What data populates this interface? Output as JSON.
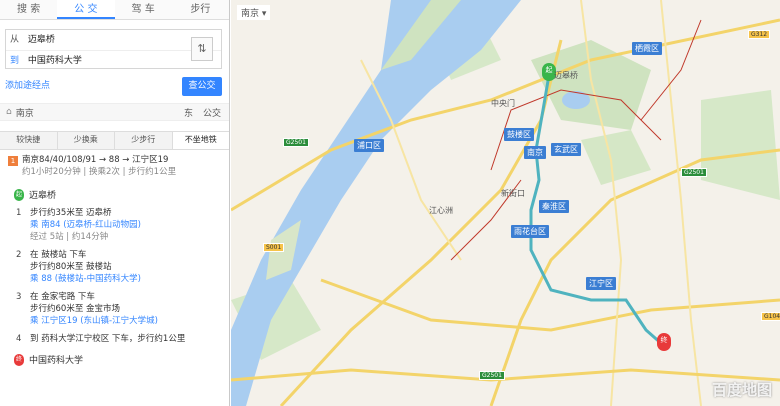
{
  "panel": {
    "tabs": [
      "搜 索",
      "公 交",
      "驾 车",
      "步行"
    ],
    "from_label": "从",
    "from_value": "迈皋桥",
    "to_label": "到",
    "to_value": "中国药科大学",
    "more_link": "添加途经点",
    "search_button": "查公交",
    "city_icon": "home-icon",
    "city": "南京",
    "city_right": [
      "东",
      "公交"
    ],
    "options": [
      "较快捷",
      "少换乘",
      "少步行",
      "不坐地铁"
    ],
    "summary_num": "1",
    "summary_line": "南京84/40/108/91 → 88 → 江宁区19",
    "summary_sub": "约1小时20分钟 | 换乘2次 | 步行约1公里",
    "start_station": "迈皋桥",
    "steps": [
      {
        "n": "1",
        "l1": "步行约35米至 迈皋桥",
        "l2": "乘 南84 (迈皋桥-红山动物园)",
        "l3": "经过 5站 | 约14分钟"
      },
      {
        "n": "2",
        "l1": "在 鼓楼站 下车",
        "l2": "步行约80米至 鼓楼站",
        "l3": "乘 88 (鼓楼站-中国药科大学)"
      },
      {
        "n": "3",
        "l1": "在 金家宅路 下车",
        "l2": "步行约60米至 金宝市场",
        "l3": "乘 江宁区19 (东山镇-江宁大学城)"
      },
      {
        "n": "4",
        "l1": "到 药科大学江宁校区 下车，步行约1公里"
      }
    ],
    "end_station": "中国药科大学"
  },
  "map": {
    "city_select": "南京",
    "labels": [
      {
        "t": "迈皋桥",
        "k": "l1"
      },
      {
        "t": "玄武区",
        "k": "l2"
      },
      {
        "t": "鼓楼区",
        "k": "l3"
      },
      {
        "t": "南京",
        "k": "l4"
      },
      {
        "t": "秦淮区",
        "k": "l5"
      },
      {
        "t": "雨花台区",
        "k": "l6"
      },
      {
        "t": "江宁区",
        "k": "l7"
      },
      {
        "t": "浦口区",
        "k": "l8"
      },
      {
        "t": "栖霞区",
        "k": "l9"
      },
      {
        "t": "中央门",
        "k": "l10"
      },
      {
        "t": "新街口",
        "k": "l11"
      },
      {
        "t": "江心洲",
        "k": "l12"
      }
    ],
    "roads": [
      "G2501",
      "G2501",
      "S001",
      "G2501",
      "G312",
      "G104"
    ],
    "start_pin": "起",
    "end_pin": "终",
    "watermark": "百度地图"
  }
}
